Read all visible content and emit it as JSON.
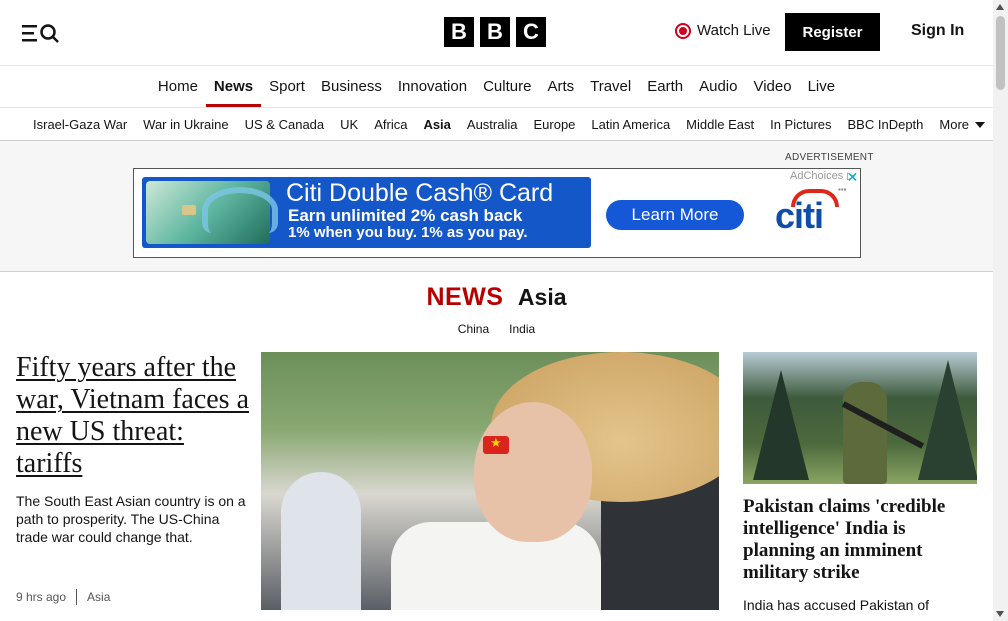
{
  "header": {
    "logo_letters": [
      "B",
      "B",
      "C"
    ],
    "watch_live": "Watch Live",
    "register": "Register",
    "sign_in": "Sign In",
    "icons": {
      "menu": "menu-icon",
      "search": "search-icon",
      "live": "live-dot-icon"
    },
    "live_color": "#d0021b"
  },
  "main_nav": {
    "items": [
      "Home",
      "News",
      "Sport",
      "Business",
      "Innovation",
      "Culture",
      "Arts",
      "Travel",
      "Earth",
      "Audio",
      "Video",
      "Live"
    ],
    "active": "News",
    "accent": "#b80000"
  },
  "sub_nav": {
    "items": [
      "Israel-Gaza War",
      "War in Ukraine",
      "US & Canada",
      "UK",
      "Africa",
      "Asia",
      "Australia",
      "Europe",
      "Latin America",
      "Middle East",
      "In Pictures",
      "BBC InDepth"
    ],
    "active": "Asia",
    "more": "More"
  },
  "advert": {
    "label": "ADVERTISEMENT",
    "title": "Citi Double Cash® Card",
    "line1": "Earn unlimited 2% cash back",
    "line2": "1% when you buy. 1% as you pay.",
    "cta": "Learn More",
    "brand": "citi",
    "adchoices": "AdChoices",
    "brand_color": "#1457c8"
  },
  "section": {
    "news": "NEWS",
    "region": "Asia",
    "subsections": [
      "China",
      "India"
    ]
  },
  "lead_story": {
    "headline": "Fifty years after the war, Vietnam faces a new US threat: tariffs",
    "summary": "The South East Asian country is on a path to prosperity. The US-China trade war could change that.",
    "time": "9 hrs ago",
    "category": "Asia"
  },
  "right_story": {
    "headline": "Pakistan claims 'credible intelligence' India is planning an imminent military strike",
    "summary": "India has accused Pakistan of"
  }
}
